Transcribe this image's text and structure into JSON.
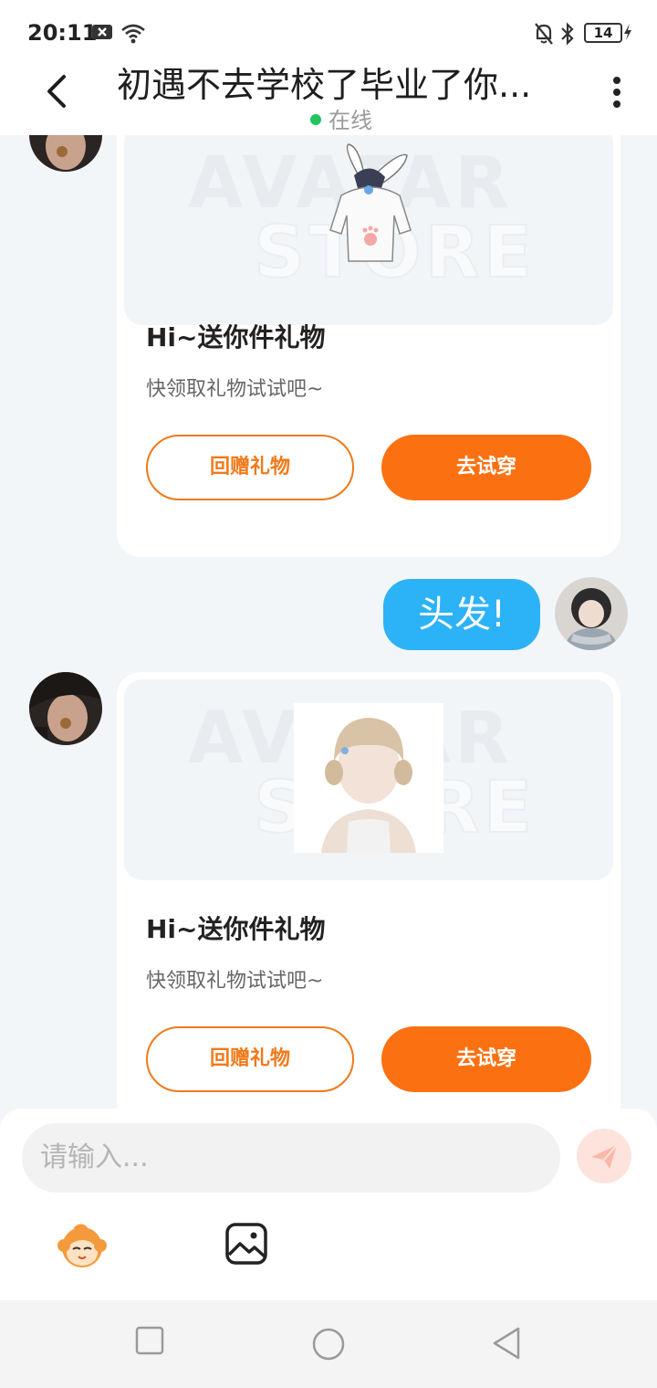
{
  "status_bar": {
    "time": "20:11",
    "battery": "14"
  },
  "header": {
    "title": "初遇不去学校了毕业了你...",
    "status": "在线"
  },
  "gift_cards": [
    {
      "title": "Hi~送你件礼物",
      "subtitle": "快领取礼物试试吧~",
      "return_gift_label": "回赠礼物",
      "try_on_label": "去试穿",
      "watermark_top": "AVATAR",
      "watermark_bottom": "STORE"
    },
    {
      "title": "Hi~送你件礼物",
      "subtitle": "快领取礼物试试吧~",
      "return_gift_label": "回赠礼物",
      "try_on_label": "去试穿",
      "watermark_top": "AVATAR",
      "watermark_bottom": "STORE"
    }
  ],
  "sent_message": {
    "text": "头发!"
  },
  "composer": {
    "placeholder": "请输入..."
  },
  "colors": {
    "accent_orange": "#fb7112",
    "bubble_blue": "#2cb3f7",
    "online_green": "#21c45d"
  },
  "icons": [
    "back-arrow-icon",
    "more-vertical-icon",
    "send-icon",
    "emoji-mascot-icon",
    "image-icon",
    "wifi-icon",
    "bluetooth-icon",
    "mute-bell-icon"
  ]
}
